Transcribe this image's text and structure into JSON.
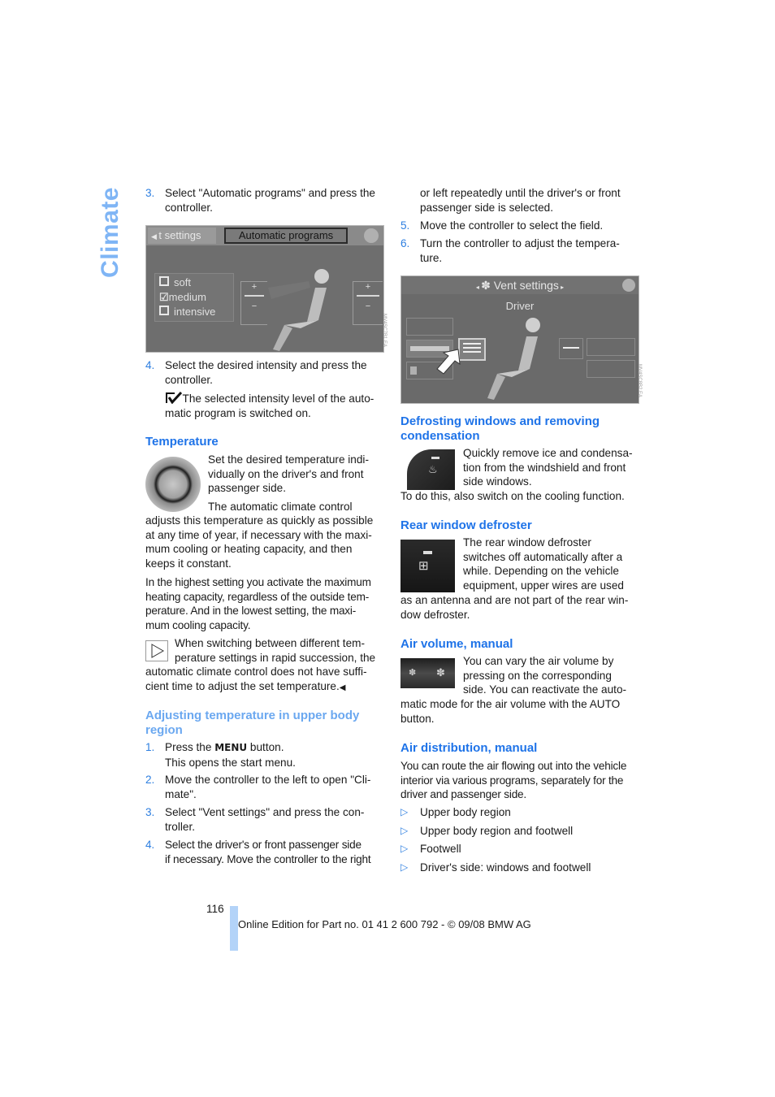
{
  "side_tab": {
    "label": "Climate"
  },
  "left": {
    "step3": {
      "num": "3.",
      "text1": "Select \"Automatic programs\" and press the",
      "text2": "controller."
    },
    "screen1": {
      "tab_prev": "t settings",
      "tab_active": "Automatic programs",
      "options": [
        {
          "label": "soft",
          "checked": false
        },
        {
          "label": "medium",
          "checked": true
        },
        {
          "label": "intensive",
          "checked": false
        }
      ],
      "plus": "+",
      "minus": "−",
      "side_code": "MV4SC7B1.EA"
    },
    "step4": {
      "num": "4.",
      "text1": "Select the desired intensity and press the",
      "text2": "controller."
    },
    "note_check": {
      "text1": "The selected intensity level of the auto-",
      "text2": "matic program is switched on."
    },
    "temperature": {
      "heading": "Temperature",
      "lines_wrap": [
        "Set the desired temperature indi-",
        "vidually on the driver's and front",
        "passenger side.",
        "The automatic climate control"
      ],
      "lines_full": [
        "adjusts this temperature as quickly as possible",
        "at any time of year, if necessary with the maxi-",
        "mum cooling or heating capacity, and then",
        "keeps it constant."
      ],
      "para2": [
        "In the highest setting you activate the maximum",
        "heating capacity, regardless of the outside tem-",
        "perature. And in the lowest setting, the maxi-",
        "mum cooling capacity."
      ],
      "note_wrap": [
        "When switching between different tem-",
        "perature settings in rapid succession, the"
      ],
      "note_full": [
        "automatic climate control does not have suffi-",
        "cient time to adjust the set temperature."
      ],
      "end_mark": "◀"
    },
    "upper_body": {
      "heading1": "Adjusting temperature in upper body",
      "heading2": "region",
      "steps": [
        {
          "num": "1.",
          "lines": [
            "Press the ",
            "MENU",
            " button.",
            "This opens the start menu."
          ]
        },
        {
          "num": "2.",
          "lines": [
            "Move the controller to the left to open \"Cli-",
            "mate\"."
          ]
        },
        {
          "num": "3.",
          "lines": [
            "Select \"Vent settings\" and press the con-",
            "troller."
          ]
        },
        {
          "num": "4.",
          "lines": [
            "Select the driver's or front passenger side",
            "if necessary. Move the controller to the right"
          ]
        }
      ]
    }
  },
  "right": {
    "cont": [
      "or left repeatedly until the driver's or front",
      "passenger side is selected."
    ],
    "step5": {
      "num": "5.",
      "text": "Move the controller to select the field."
    },
    "step6": {
      "num": "6.",
      "text1": "Turn the controller to adjust the tempera-",
      "text2": "ture."
    },
    "screen2": {
      "title": "Vent settings",
      "subtitle": "Driver",
      "side_code": "MV4SC8B2.EA"
    },
    "defrost": {
      "heading1": "Defrosting windows and removing",
      "heading2": "condensation",
      "wrap": [
        "Quickly remove ice and condensa-",
        "tion from the windshield and front",
        "side windows."
      ],
      "full": [
        "To do this, also switch on the cooling function."
      ]
    },
    "rear": {
      "heading": "Rear window defroster",
      "wrap": [
        "The rear window defroster",
        "switches off automatically after a",
        "while. Depending on the vehicle",
        "equipment, upper wires are used"
      ],
      "full": [
        "as an antenna and are not part of the rear win-",
        "dow defroster."
      ]
    },
    "air_volume": {
      "heading": "Air volume, manual",
      "wrap": [
        "You can vary the air volume by",
        "pressing on the corresponding",
        "side. You can reactivate the auto-"
      ],
      "full": [
        "matic mode for the air volume with the AUTO",
        "button."
      ]
    },
    "air_dist": {
      "heading": "Air distribution, manual",
      "para": [
        "You can route the air flowing out into the vehicle",
        "interior via various programs, separately for the",
        "driver and passenger side."
      ],
      "bullets": [
        "Upper body region",
        "Upper body region and footwell",
        "Footwell",
        "Driver's side: windows and footwell"
      ]
    }
  },
  "footer": {
    "page_number": "116",
    "text": "Online Edition for Part no. 01 41 2 600 792 - © 09/08 BMW AG"
  }
}
